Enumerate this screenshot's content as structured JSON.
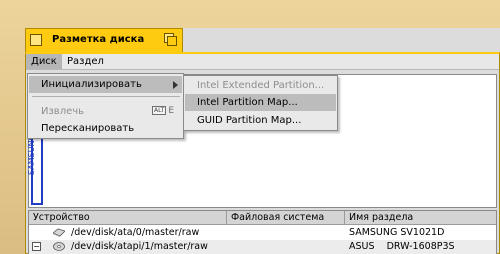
{
  "window": {
    "title": "Разметка диска"
  },
  "menubar": {
    "items": [
      {
        "label": "Диск"
      },
      {
        "label": "Раздел"
      }
    ]
  },
  "disk_menu": {
    "initialize_label": "Инициализировать",
    "eject_label": "Извлечь",
    "eject_shortcut_modifier": "ALT",
    "eject_shortcut_key": "E",
    "rescan_label": "Пересканировать"
  },
  "initialize_submenu": {
    "items": [
      {
        "label": "Intel Extended Partition...",
        "enabled": false
      },
      {
        "label": "Intel Partition Map...",
        "enabled": true,
        "highlighted": true
      },
      {
        "label": "GUID Partition Map...",
        "enabled": true
      }
    ]
  },
  "disk_map": {
    "vertical_label": "SAMSUNG SV"
  },
  "table": {
    "columns": [
      "Устройство",
      "Файловая система",
      "Имя раздела"
    ],
    "rows": [
      {
        "device": "/dev/disk/ata/0/master/raw",
        "filesystem": "",
        "partition_name": "SAMSUNG SV1021D",
        "icon": "hard-disk-icon",
        "expander": ""
      },
      {
        "device": "/dev/disk/atapi/1/master/raw",
        "filesystem": "",
        "partition_name": "ASUS    DRW-1608P3S",
        "icon": "optical-disc-icon",
        "expander": "⊟"
      }
    ]
  },
  "colors": {
    "tab_yellow": "#ffcb10",
    "selection_gray": "#bcbcbc",
    "disk_bar_blue": "#1f3cc2",
    "desktop_tan": "#e4c98f"
  }
}
